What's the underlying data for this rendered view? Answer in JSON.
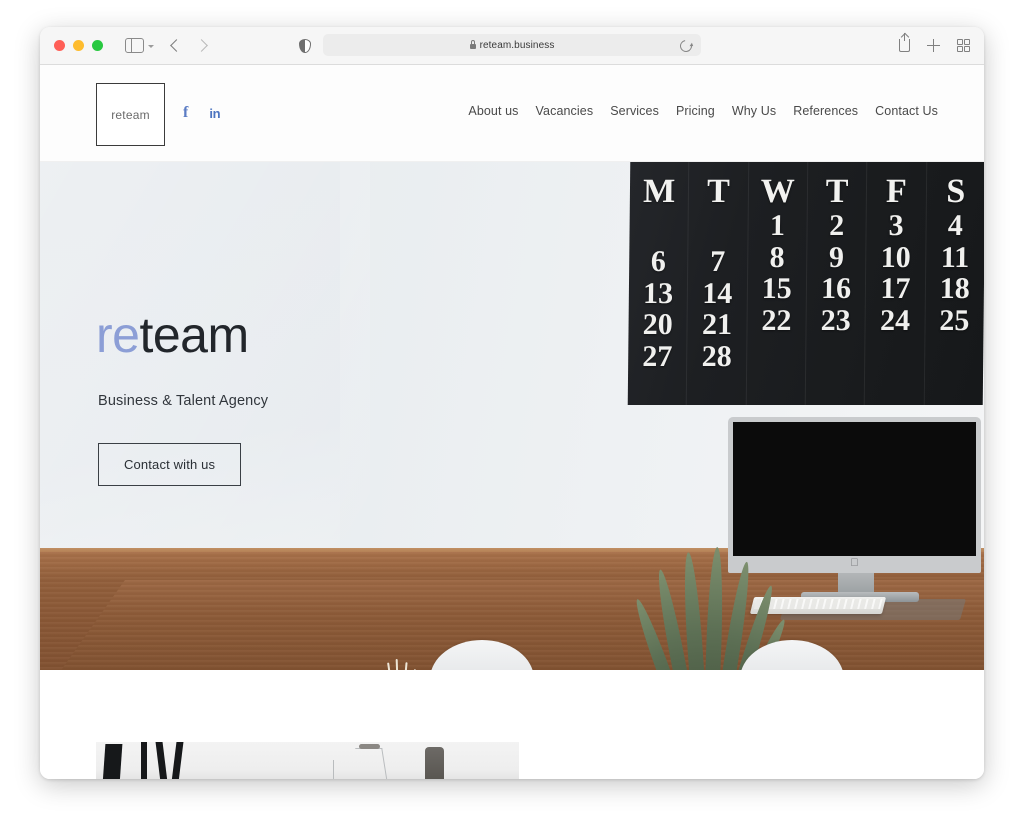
{
  "browser": {
    "url": "reteam.business",
    "icons": {
      "sidebar": "sidebar-toggle-icon",
      "sidebar_chevron": "chevron-down-icon",
      "back": "back-arrow-icon",
      "forward": "forward-arrow-icon",
      "shield": "privacy-shield-icon",
      "lock": "lock-icon",
      "reload": "reload-icon",
      "share": "share-icon",
      "new_tab": "plus-icon",
      "tab_overview": "tab-overview-icon"
    },
    "traffic_lights": {
      "close": "#ff5f57",
      "minimize": "#febc2e",
      "zoom": "#28c840"
    }
  },
  "site": {
    "logo_text": "reteam",
    "social": [
      {
        "name": "facebook",
        "glyph": "f"
      },
      {
        "name": "linkedin",
        "glyph": "in"
      }
    ],
    "nav": [
      {
        "label": "About us"
      },
      {
        "label": "Vacancies"
      },
      {
        "label": "Services"
      },
      {
        "label": "Pricing"
      },
      {
        "label": "Why Us"
      },
      {
        "label": "References"
      },
      {
        "label": "Contact Us"
      }
    ],
    "hero": {
      "title_accent": "re",
      "title_plain": "team",
      "subtitle": "Business & Talent Agency",
      "cta_label": "Contact with us"
    },
    "colors": {
      "accent_blue": "#8c9ed6",
      "social_blue": "#5b7cc4",
      "hero_text": "#22262b",
      "hero_bg": "#e3e8ec"
    }
  },
  "hero_photo": {
    "calendar": {
      "columns": [
        {
          "header": "M",
          "days": [
            "6",
            "13",
            "20",
            "27"
          ],
          "lead_blank": 1
        },
        {
          "header": "T",
          "days": [
            "7",
            "14",
            "21",
            "28"
          ],
          "lead_blank": 1
        },
        {
          "header": "W",
          "days": [
            "1",
            "8",
            "15",
            "22"
          ],
          "lead_blank": 0
        },
        {
          "header": "T",
          "days": [
            "2",
            "9",
            "16",
            "23"
          ],
          "lead_blank": 0
        },
        {
          "header": "F",
          "days": [
            "3",
            "10",
            "17",
            "24"
          ],
          "lead_blank": 0
        },
        {
          "header": "S",
          "days": [
            "4",
            "11",
            "18",
            "25"
          ],
          "lead_blank": 0
        }
      ]
    },
    "objects": [
      "wall-calendar",
      "imac-monitor",
      "apple-keyboard",
      "snake-plant",
      "reed-diffuser",
      "wooden-desk",
      "white-chairs"
    ]
  }
}
